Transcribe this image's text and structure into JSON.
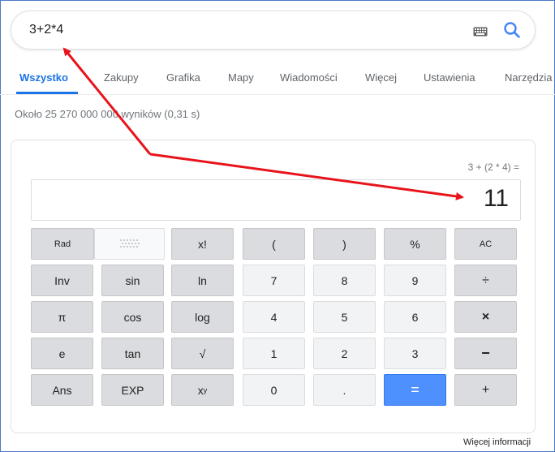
{
  "search": {
    "query": "3+2*4"
  },
  "icons": {
    "keyboard": "keyboard-icon",
    "search": "search-icon",
    "deg_toggle": "dotted-toggle-icon"
  },
  "tabs": [
    {
      "label": "Wszystko",
      "active": true
    },
    {
      "label": "Zakupy",
      "active": false
    },
    {
      "label": "Grafika",
      "active": false
    },
    {
      "label": "Mapy",
      "active": false
    },
    {
      "label": "Wiadomości",
      "active": false
    },
    {
      "label": "Więcej",
      "active": false
    },
    {
      "label": "Ustawienia",
      "active": false
    },
    {
      "label": "Narzędzia",
      "active": false
    }
  ],
  "results_count": "Około 25 270 000 000 wyników (0,31 s)",
  "calculator": {
    "expression": "3 + (2 * 4) =",
    "result": "11",
    "keys": {
      "rad": "Rad",
      "factorial": "x!",
      "open_paren": "(",
      "close_paren": ")",
      "percent": "%",
      "clear": "AC",
      "inv": "Inv",
      "sin": "sin",
      "ln": "ln",
      "seven": "7",
      "eight": "8",
      "nine": "9",
      "divide": "÷",
      "pi": "π",
      "cos": "cos",
      "log": "log",
      "four": "4",
      "five": "5",
      "six": "6",
      "multiply": "×",
      "e": "e",
      "tan": "tan",
      "sqrt": "√",
      "one": "1",
      "two": "2",
      "three": "3",
      "minus": "−",
      "ans": "Ans",
      "exp": "EXP",
      "power_base": "x",
      "power_exp": "y",
      "zero": "0",
      "dot": ".",
      "equals": "=",
      "plus": "+"
    }
  },
  "more_info": "Więcej informacji",
  "colors": {
    "accent": "#1a73e8",
    "equals_key": "#4d90fe",
    "annotation_arrow": "#e8141c"
  }
}
